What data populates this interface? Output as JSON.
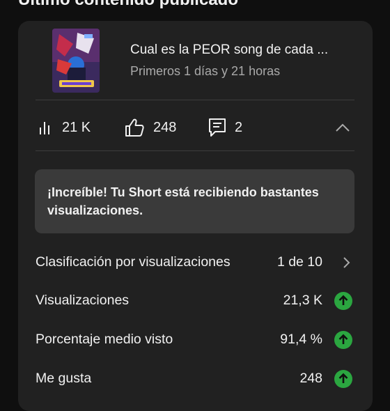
{
  "section": {
    "title": "Último contenido publicado"
  },
  "video": {
    "title": "Cual es la PEOR song de cada ...",
    "subtitle": "Primeros 1 días y 21 horas"
  },
  "stats": {
    "views": "21 K",
    "likes": "248",
    "comments": "2"
  },
  "banner": {
    "text": "¡Increíble! Tu Short está recibiendo bastantes visualizaciones."
  },
  "rows": [
    {
      "label": "Clasificación por visualizaciones",
      "value": "1 de 10",
      "indicator": "chevron-right-icon"
    },
    {
      "label": "Visualizaciones",
      "value": "21,3 K",
      "indicator": "arrow-up-icon"
    },
    {
      "label": "Porcentaje medio visto",
      "value": "91,4 %",
      "indicator": "arrow-up-icon"
    },
    {
      "label": "Me gusta",
      "value": "248",
      "indicator": "arrow-up-icon"
    }
  ],
  "colors": {
    "background": "#0f0f0f",
    "card": "#212121",
    "banner": "#3a3a3a",
    "positive": "#2ba640",
    "secondary_text": "#aaaaaa"
  }
}
